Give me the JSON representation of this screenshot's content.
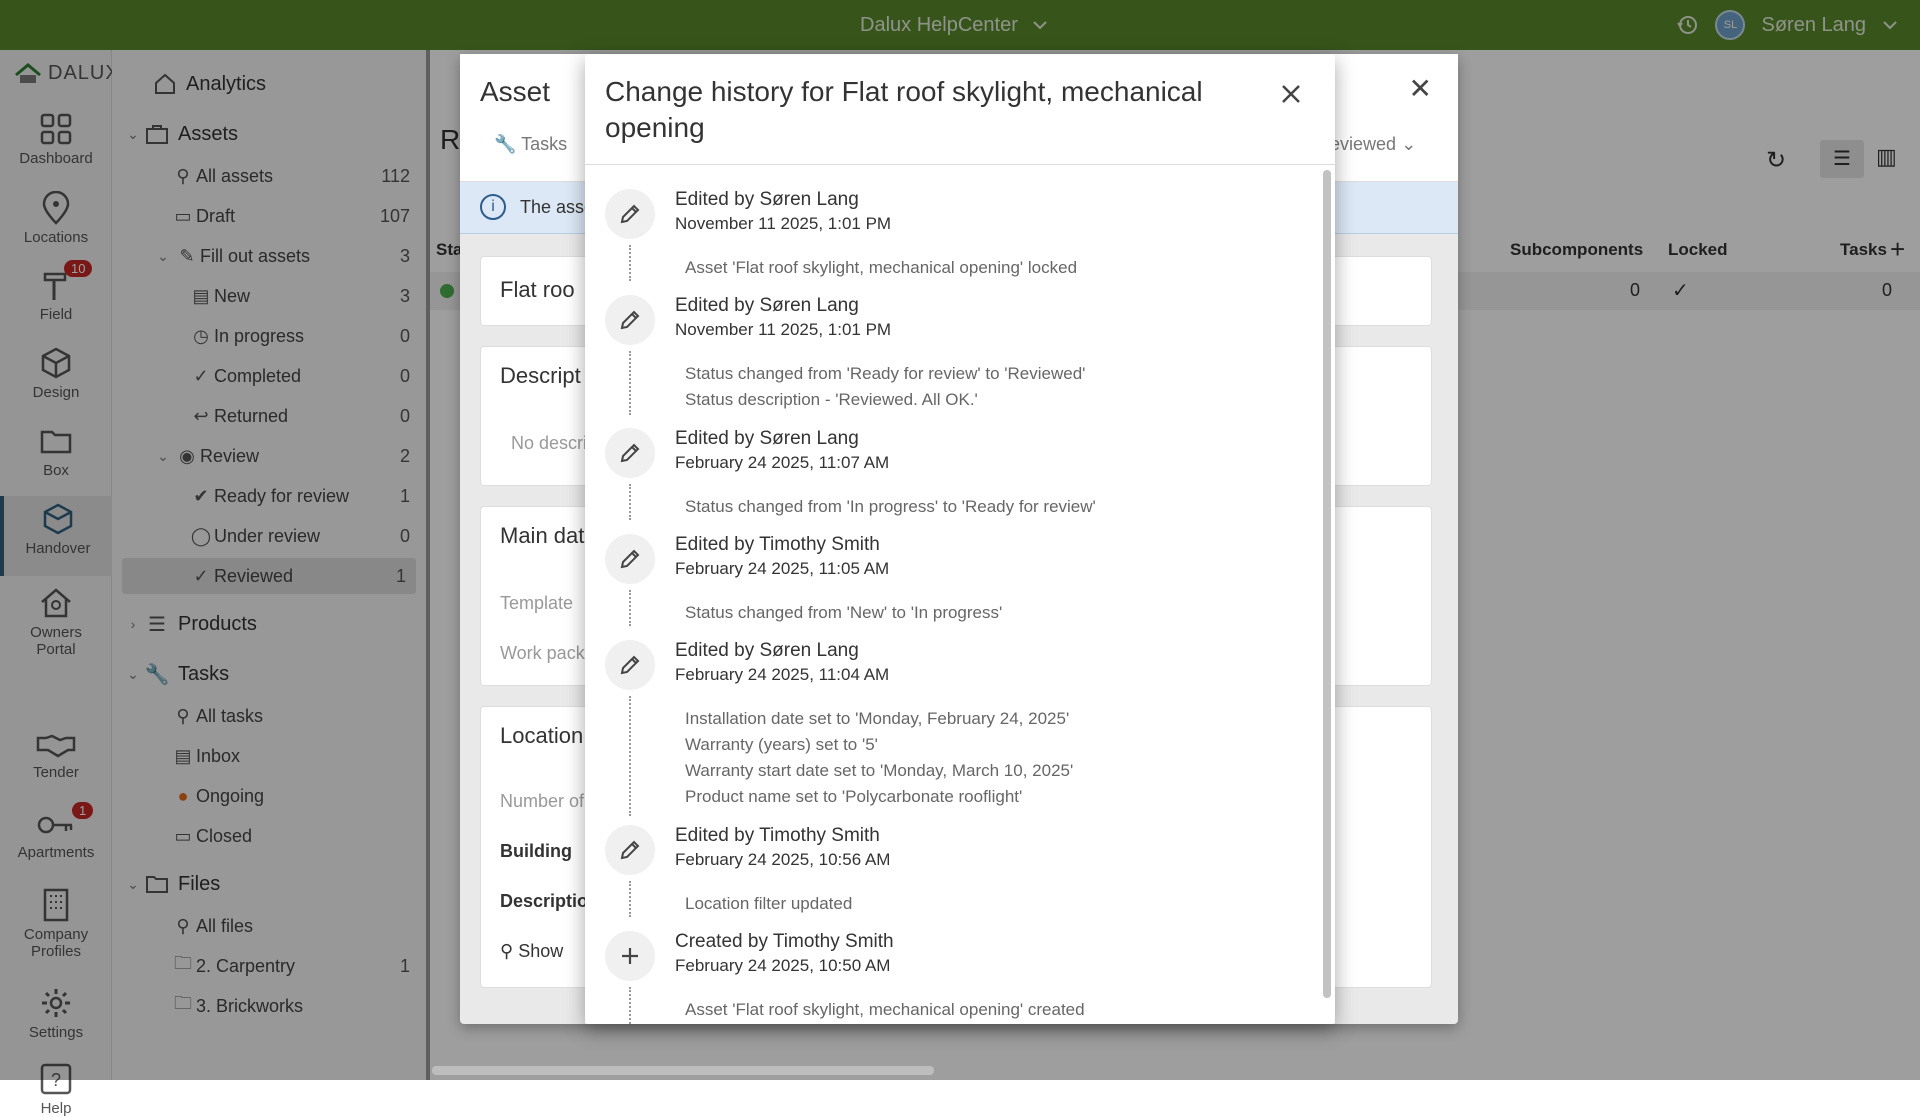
{
  "topbar": {
    "app_name": "Dalux HelpCenter",
    "user_initials": "SL",
    "user_name": "Søren Lang"
  },
  "rail": {
    "logo": "DALUX",
    "items": [
      {
        "label": "Dashboard",
        "icon": "grid-icon"
      },
      {
        "label": "Locations",
        "icon": "pin-icon"
      },
      {
        "label": "Field",
        "icon": "hammer-icon",
        "badge": "10"
      },
      {
        "label": "Design",
        "icon": "cube-icon"
      },
      {
        "label": "Box",
        "icon": "folder-icon"
      },
      {
        "label": "Handover",
        "icon": "box-icon",
        "active": true
      },
      {
        "label": "Owners Portal",
        "icon": "house-icon"
      },
      {
        "label": "Tender",
        "icon": "handshake-icon"
      },
      {
        "label": "Apartments",
        "icon": "key-icon",
        "badge": "1"
      },
      {
        "label": "Company Profiles",
        "icon": "building-icon"
      },
      {
        "label": "Settings",
        "icon": "gear-icon"
      },
      {
        "label": "Help",
        "icon": "help-icon"
      }
    ]
  },
  "nav": {
    "analytics": "Analytics",
    "assets": "Assets",
    "all_assets": "All assets",
    "all_assets_count": "112",
    "draft": "Draft",
    "draft_count": "107",
    "fill_out": "Fill out assets",
    "fill_out_count": "3",
    "new": "New",
    "new_count": "3",
    "in_progress": "In progress",
    "in_progress_count": "0",
    "completed": "Completed",
    "completed_count": "0",
    "returned": "Returned",
    "returned_count": "0",
    "review": "Review",
    "review_count": "2",
    "ready_for_review": "Ready for review",
    "ready_for_review_count": "1",
    "under_review": "Under review",
    "under_review_count": "0",
    "reviewed": "Reviewed",
    "reviewed_count": "1",
    "products": "Products",
    "tasks": "Tasks",
    "all_tasks": "All tasks",
    "inbox": "Inbox",
    "ongoing": "Ongoing",
    "closed": "Closed",
    "files": "Files",
    "all_files": "All files",
    "carpentry": "2. Carpentry",
    "carpentry_count": "1",
    "brickworks": "3. Brickworks"
  },
  "main": {
    "title_initial": "R",
    "col_status": "Sta",
    "col_subcomponents": "Subcomponents",
    "col_locked": "Locked",
    "col_tasks": "Tasks",
    "row_subcomponents": "0",
    "row_tasks": "0",
    "filter_reviewed": "eviewed"
  },
  "asset_dialog": {
    "title": "Asset",
    "tab_tasks": "Tasks",
    "info_text": "The asse",
    "card_flat_roof": "Flat roo",
    "card_description": "Descript",
    "no_description": "No descri",
    "card_main_data": "Main dat",
    "template_label": "Template",
    "work_package_label": "Work pack",
    "card_location": "Location",
    "number_of_label": "Number of",
    "building_label": "Building",
    "description_label": "Description",
    "show_button": "Show"
  },
  "history": {
    "title": "Change history for Flat roof skylight, mechanical opening",
    "entries": [
      {
        "who": "Edited by Søren Lang",
        "when": "November 11 2025, 1:01 PM",
        "icon": "pencil-icon",
        "changes": [
          "Asset 'Flat roof skylight, mechanical opening' locked"
        ]
      },
      {
        "who": "Edited by Søren Lang",
        "when": "November 11 2025, 1:01 PM",
        "icon": "pencil-icon",
        "changes": [
          "Status changed from 'Ready for review' to 'Reviewed'",
          "Status description - 'Reviewed. All OK.'"
        ]
      },
      {
        "who": "Edited by Søren Lang",
        "when": "February 24 2025, 11:07 AM",
        "icon": "pencil-icon",
        "changes": [
          "Status changed from 'In progress' to 'Ready for review'"
        ]
      },
      {
        "who": "Edited by Timothy Smith",
        "when": "February 24 2025, 11:05 AM",
        "icon": "pencil-icon",
        "changes": [
          "Status changed from 'New' to 'In progress'"
        ]
      },
      {
        "who": "Edited by Søren Lang",
        "when": "February 24 2025, 11:04 AM",
        "icon": "pencil-icon",
        "changes": [
          "Installation date set to 'Monday, February 24, 2025'",
          "Warranty (years) set to '5'",
          "Warranty start date set to 'Monday, March 10, 2025'",
          "Product name set to 'Polycarbonate rooflight'"
        ]
      },
      {
        "who": "Edited by Timothy Smith",
        "when": "February 24 2025, 10:56 AM",
        "icon": "pencil-icon",
        "changes": [
          "Location filter updated"
        ]
      },
      {
        "who": "Created by Timothy Smith",
        "when": "February 24 2025, 10:50 AM",
        "icon": "plus-icon",
        "changes": [
          "Asset 'Flat roof skylight, mechanical opening' created"
        ]
      }
    ]
  }
}
